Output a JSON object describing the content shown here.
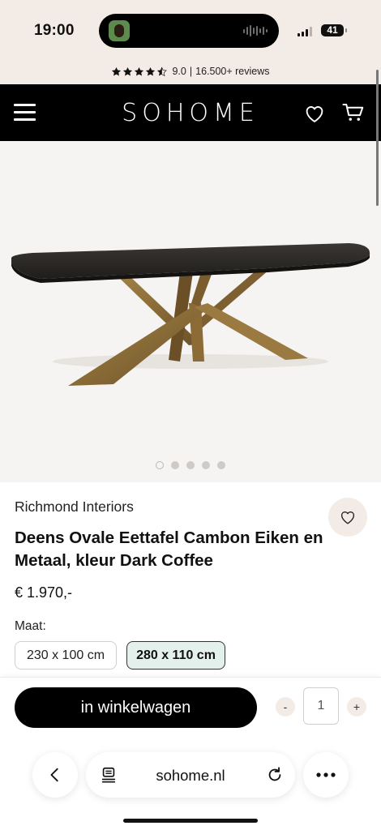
{
  "status_bar": {
    "time": "19:00",
    "battery": "41",
    "signal_icon": "cellular-signal-icon"
  },
  "reviews": {
    "rating": "9.0",
    "separator": "|",
    "count": "16.500+ reviews",
    "stars_filled": 4.5
  },
  "header": {
    "logo": "SOHOME",
    "menu_icon": "hamburger-menu-icon",
    "wishlist_icon": "heart-icon",
    "cart_icon": "shopping-cart-icon"
  },
  "gallery": {
    "image_description_icon": "product-photo",
    "slides": 5,
    "active_slide": 1
  },
  "product": {
    "brand": "Richmond Interiors",
    "title": "Deens Ovale Eettafel Cambon Eiken en Metaal, kleur Dark Coffee",
    "price": "€ 1.970,-",
    "size_label": "Maat:",
    "sizes": [
      {
        "label": "230 x 100 cm",
        "selected": false
      },
      {
        "label": "280 x 110 cm",
        "selected": true
      }
    ]
  },
  "cart": {
    "add_label": "in winkelwagen",
    "minus": "-",
    "plus": "+",
    "quantity": "1"
  },
  "browser": {
    "url": "sohome.nl",
    "back_icon": "chevron-left-icon",
    "reader_icon": "page-icon",
    "reload_icon": "reload-icon",
    "more_icon": "more-dots-icon"
  },
  "colors": {
    "header_bg": "#000000",
    "strip_bg": "#f3ebe5",
    "selected_size_bg": "#e3f0ec",
    "table_top": "#2b2926",
    "table_legs": "#8a6a3a"
  }
}
